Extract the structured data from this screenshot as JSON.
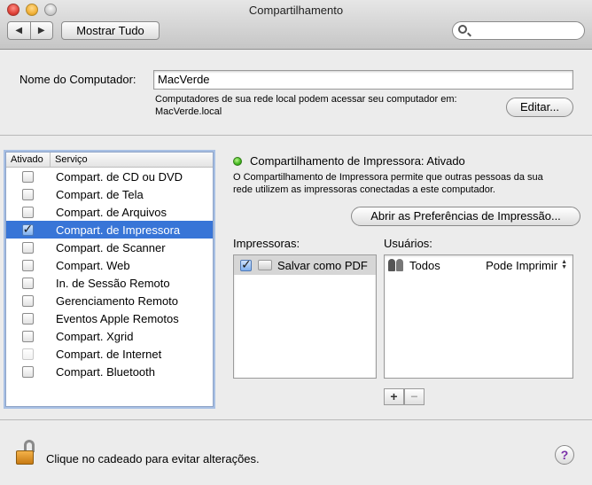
{
  "window": {
    "title": "Compartilhamento"
  },
  "toolbar": {
    "back_icon": "◀",
    "forward_icon": "▶",
    "show_all_label": "Mostrar Tudo",
    "search_placeholder": ""
  },
  "computer_name": {
    "label": "Nome do Computador:",
    "value": "MacVerde",
    "description_line1": "Computadores de sua rede local podem acessar seu computador em:",
    "description_line2": "MacVerde.local",
    "edit_button": "Editar..."
  },
  "services": {
    "header_enabled": "Ativado",
    "header_service": "Serviço",
    "items": [
      {
        "label": "Compart. de CD ou DVD",
        "checked": false,
        "selected": false
      },
      {
        "label": "Compart. de Tela",
        "checked": false,
        "selected": false
      },
      {
        "label": "Compart. de Arquivos",
        "checked": false,
        "selected": false
      },
      {
        "label": "Compart. de Impressora",
        "checked": true,
        "selected": true
      },
      {
        "label": "Compart. de Scanner",
        "checked": false,
        "selected": false
      },
      {
        "label": "Compart. Web",
        "checked": false,
        "selected": false
      },
      {
        "label": "In. de Sessão Remoto",
        "checked": false,
        "selected": false
      },
      {
        "label": "Gerenciamento Remoto",
        "checked": false,
        "selected": false
      },
      {
        "label": "Eventos Apple Remotos",
        "checked": false,
        "selected": false
      },
      {
        "label": "Compart. Xgrid",
        "checked": false,
        "selected": false
      },
      {
        "label": "Compart. de Internet",
        "checked": false,
        "selected": false,
        "disabled": true
      },
      {
        "label": "Compart. Bluetooth",
        "checked": false,
        "selected": false
      }
    ]
  },
  "detail": {
    "status_title": "Compartilhamento de Impressora: Ativado",
    "status_color": "#3fb51c",
    "description_line1": "O Compartilhamento de Impressora permite que outras pessoas da sua",
    "description_line2": "rede utilizem as impressoras conectadas a este computador.",
    "print_prefs_button": "Abrir as Preferências de Impressão...",
    "printers_label": "Impressoras:",
    "users_label": "Usuários:",
    "printers": [
      {
        "label": "Salvar como PDF",
        "checked": true
      }
    ],
    "users": [
      {
        "label": "Todos",
        "permission": "Pode Imprimir"
      }
    ],
    "add_label": "+",
    "remove_label": "−"
  },
  "footer": {
    "lock_text": "Clique no cadeado para evitar alterações.",
    "help_label": "?"
  },
  "colors": {
    "selection": "#3875d7",
    "window_bg": "#ececec"
  }
}
